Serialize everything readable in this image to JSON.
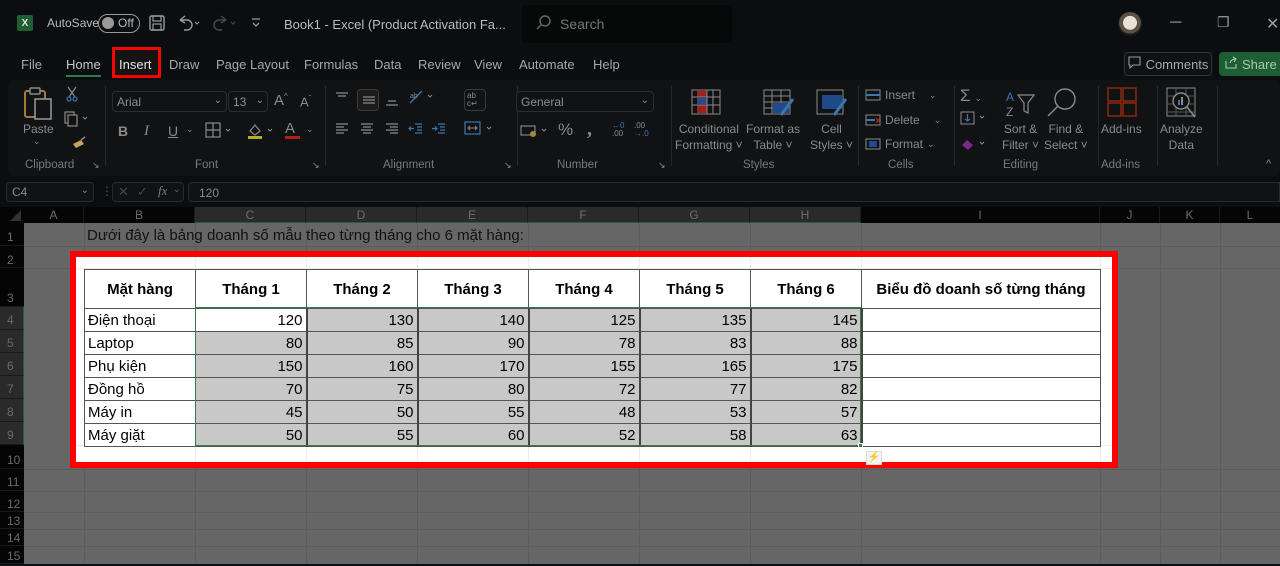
{
  "titlebar": {
    "app_icon": "excel-logo-icon",
    "app_icon_letter": "X",
    "autosave_label": "AutoSave",
    "autosave_state": "Off",
    "doc_title": "Book1  -  Excel (Product Activation Fa...",
    "search_placeholder": "Search",
    "window_controls": {
      "minimize": "─",
      "restore": "❐",
      "close": "✕"
    }
  },
  "ribbon_tabs": [
    {
      "label": "File"
    },
    {
      "label": "Home",
      "active": true
    },
    {
      "label": "Insert",
      "highlighted": true
    },
    {
      "label": "Draw"
    },
    {
      "label": "Page Layout"
    },
    {
      "label": "Formulas"
    },
    {
      "label": "Data"
    },
    {
      "label": "Review"
    },
    {
      "label": "View"
    },
    {
      "label": "Automate"
    },
    {
      "label": "Help"
    }
  ],
  "actions": {
    "comments_label": "Comments",
    "share_label": "Share"
  },
  "ribbon": {
    "clipboard": {
      "label": "Clipboard",
      "paste_label": "Paste"
    },
    "font": {
      "label": "Font",
      "font_name": "Arial",
      "font_size": "13",
      "bold": "B",
      "italic": "I",
      "underline": "U",
      "grow": "A",
      "shrink": "A",
      "font_color": "A"
    },
    "alignment": {
      "label": "Alignment"
    },
    "number": {
      "label": "Number",
      "format": "General",
      "percent": "%",
      "comma": "9",
      "inc_decimal": "←0\n.00",
      "dec_decimal": ".00\n→.0"
    },
    "styles": {
      "label": "Styles",
      "conditional_formatting": [
        "Conditional",
        "Formatting ˅"
      ],
      "format_as_table": [
        "Format as",
        "Table ˅"
      ],
      "cell_styles": [
        "Cell",
        "Styles ˅"
      ]
    },
    "cells": {
      "label": "Cells",
      "insert": "Insert",
      "delete": "Delete",
      "format": "Format"
    },
    "editing": {
      "label": "Editing",
      "sort_filter": [
        "Sort &",
        "Filter ˅"
      ],
      "find_select": [
        "Find &",
        "Select ˅"
      ]
    },
    "addins": {
      "label": "Add-ins",
      "addins_btn": "Add-ins"
    },
    "analyze": {
      "analyze_btn": [
        "Analyze",
        "Data"
      ]
    }
  },
  "formula_bar": {
    "name_box": "C4",
    "fx": "fx",
    "value": "120"
  },
  "columns": [
    "A",
    "B",
    "C",
    "D",
    "E",
    "F",
    "G",
    "H",
    "I",
    "J",
    "K",
    "L"
  ],
  "rows": [
    "1",
    "2",
    "3",
    "4",
    "5",
    "6",
    "7",
    "8",
    "9",
    "10",
    "11",
    "12",
    "13",
    "14",
    "15"
  ],
  "sheet": {
    "intro_text": "Dưới đây là bảng doanh số mẫu theo từng tháng cho 6 mặt hàng:",
    "headers": [
      "Mặt hàng",
      "Tháng 1",
      "Tháng 2",
      "Tháng 3",
      "Tháng 4",
      "Tháng 5",
      "Tháng 6",
      "Biểu đồ doanh số từng tháng"
    ],
    "rows": [
      {
        "name": "Điện thoại",
        "values": [
          120,
          130,
          140,
          125,
          135,
          145
        ]
      },
      {
        "name": "Laptop",
        "values": [
          80,
          85,
          90,
          78,
          83,
          88
        ]
      },
      {
        "name": "Phụ kiện",
        "values": [
          150,
          160,
          170,
          155,
          165,
          175
        ]
      },
      {
        "name": "Đồng hồ",
        "values": [
          70,
          75,
          80,
          72,
          77,
          82
        ]
      },
      {
        "name": "Máy in",
        "values": [
          45,
          50,
          55,
          48,
          53,
          57
        ]
      },
      {
        "name": "Máy giặt",
        "values": [
          50,
          55,
          60,
          52,
          58,
          63
        ]
      }
    ]
  },
  "colors": {
    "highlight_red": "#ff0000",
    "excel_green": "#1f5e34",
    "selection_green": "#2e7d4a"
  }
}
